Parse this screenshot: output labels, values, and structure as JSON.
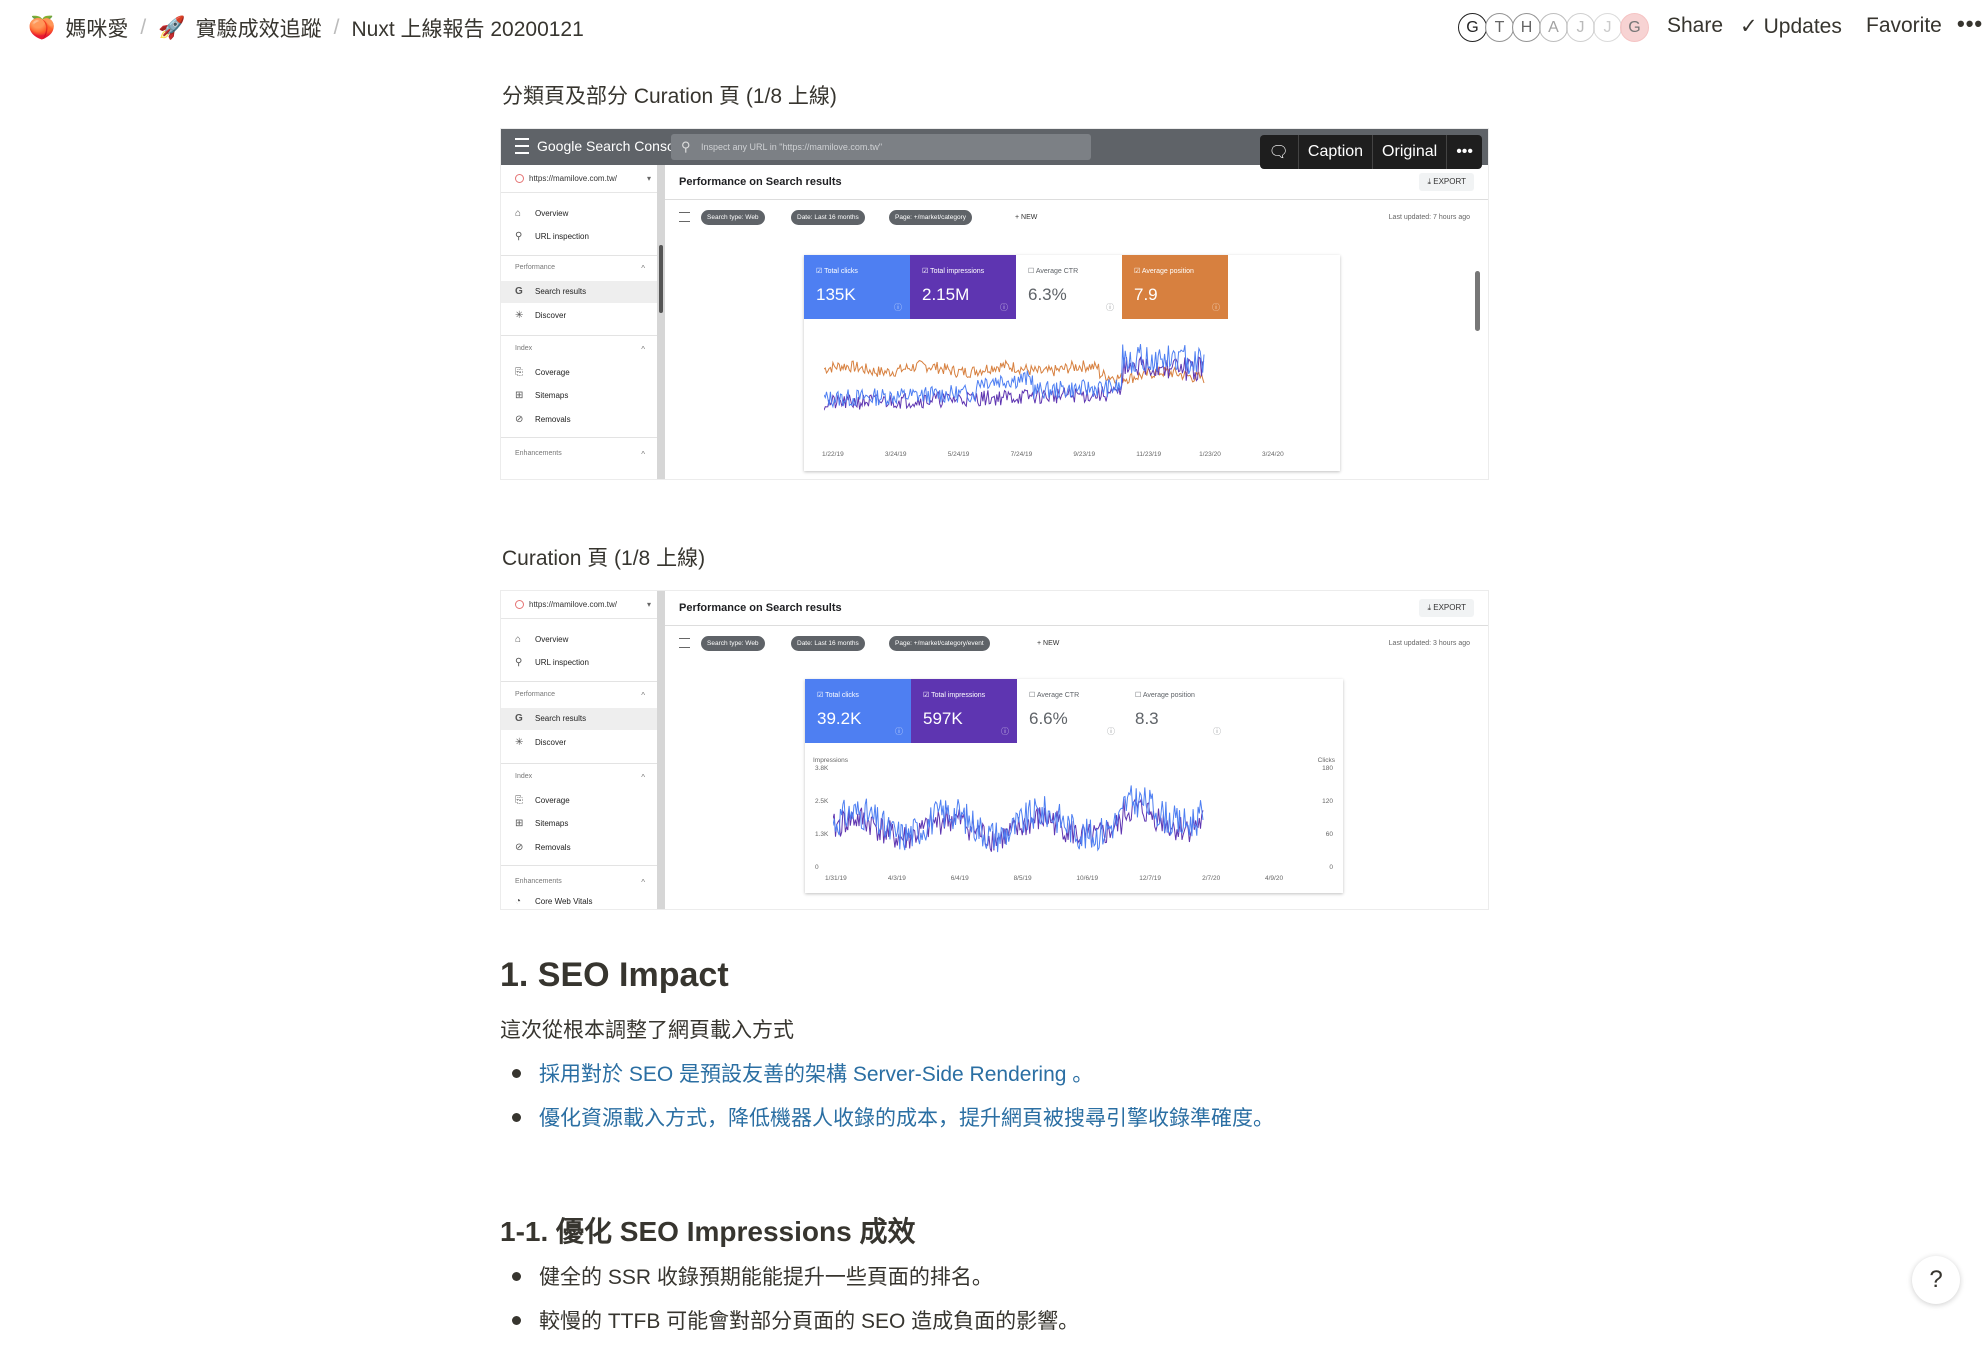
{
  "breadcrumb": [
    {
      "icon": "🍑",
      "icon_name": "page-emoji-icon",
      "label": "媽咪愛"
    },
    {
      "icon": "🚀",
      "icon_name": "rocket-icon",
      "label": "實驗成效追蹤"
    },
    {
      "icon": "",
      "icon_name": "",
      "label": "Nuxt 上線報告 20200121"
    }
  ],
  "breadcrumb_sep": "/",
  "avatars": [
    "G",
    "T",
    "H",
    "A",
    "J",
    "J",
    "G"
  ],
  "topbar": {
    "share": "Share",
    "updates": "Updates",
    "favorite": "Favorite",
    "more": "•••"
  },
  "section_captions": {
    "first": "分類頁及部分 Curation 頁 (1/8 上線)",
    "second": "Curation 頁 (1/8 上線)"
  },
  "image_toolbar": {
    "caption": "Caption",
    "original": "Original",
    "more": "•••"
  },
  "screenshot1": {
    "app_name": "Google Search Console",
    "search_placeholder": "Inspect any URL in \"https://mamilove.com.tw\"",
    "property_url": "https://mamilove.com.tw/",
    "nav": {
      "overview": "Overview",
      "url_inspection": "URL inspection",
      "performance": "Performance",
      "search_results": "Search results",
      "discover": "Discover",
      "index": "Index",
      "coverage": "Coverage",
      "sitemaps": "Sitemaps",
      "removals": "Removals",
      "enhancements": "Enhancements"
    },
    "page_title": "Performance on Search results",
    "export": "EXPORT",
    "chips": [
      "Search type: Web",
      "Date: Last 16 months",
      "Page: +/market/category"
    ],
    "new": "+ NEW",
    "last_updated": "Last updated: 7 hours ago",
    "metrics": [
      {
        "label": "Total clicks",
        "value": "135K",
        "color": "#4e7ff2"
      },
      {
        "label": "Total impressions",
        "value": "2.15M",
        "color": "#5e35b1"
      },
      {
        "label": "Average CTR",
        "value": "6.3%",
        "color": "#ffffff"
      },
      {
        "label": "Average position",
        "value": "7.9",
        "color": "#d7803f"
      }
    ],
    "x_ticks": [
      "1/22/19",
      "3/24/19",
      "5/24/19",
      "7/24/19",
      "9/23/19",
      "11/23/19",
      "1/23/20",
      "3/24/20"
    ]
  },
  "screenshot2": {
    "property_url": "https://mamilove.com.tw/",
    "nav": {
      "overview": "Overview",
      "url_inspection": "URL inspection",
      "performance": "Performance",
      "search_results": "Search results",
      "discover": "Discover",
      "index": "Index",
      "coverage": "Coverage",
      "sitemaps": "Sitemaps",
      "removals": "Removals",
      "enhancements": "Enhancements",
      "core_web_vitals": "Core Web Vitals"
    },
    "page_title": "Performance on Search results",
    "export": "EXPORT",
    "chips": [
      "Search type: Web",
      "Date: Last 16 months",
      "Page: +/market/category/event"
    ],
    "new": "+ NEW",
    "last_updated": "Last updated: 3 hours ago",
    "metrics": [
      {
        "label": "Total clicks",
        "value": "39.2K",
        "color": "#4e7ff2"
      },
      {
        "label": "Total impressions",
        "value": "597K",
        "color": "#5e35b1"
      },
      {
        "label": "Average CTR",
        "value": "6.6%",
        "color": "#ffffff"
      },
      {
        "label": "Average position",
        "value": "8.3",
        "color": "#ffffff"
      }
    ],
    "y_left_label": "Impressions",
    "y_right_label": "Clicks",
    "y_left_ticks": [
      "3.8K",
      "2.5K",
      "1.3K",
      "0"
    ],
    "y_right_ticks": [
      "180",
      "120",
      "60",
      "0"
    ],
    "x_ticks": [
      "1/31/19",
      "4/3/19",
      "6/4/19",
      "8/5/19",
      "10/6/19",
      "12/7/19",
      "2/7/20",
      "4/9/20"
    ]
  },
  "seo_impact": {
    "heading": "1. SEO Impact",
    "intro": "這次從根本調整了網頁載入方式",
    "bullets": [
      "採用對於 SEO 是預設友善的架構 Server-Side Rendering 。",
      "優化資源載入方式，降低機器人收錄的成本，提升網頁被搜尋引擎收錄準確度。"
    ]
  },
  "impressions": {
    "heading": "1-1. 優化 SEO Impressions 成效",
    "bullets": [
      "健全的 SSR 收錄預期能能提升一些頁面的排名。",
      "較慢的 TTFB 可能會對部分頁面的 SEO 造成負面的影響。"
    ]
  },
  "help": "?"
}
